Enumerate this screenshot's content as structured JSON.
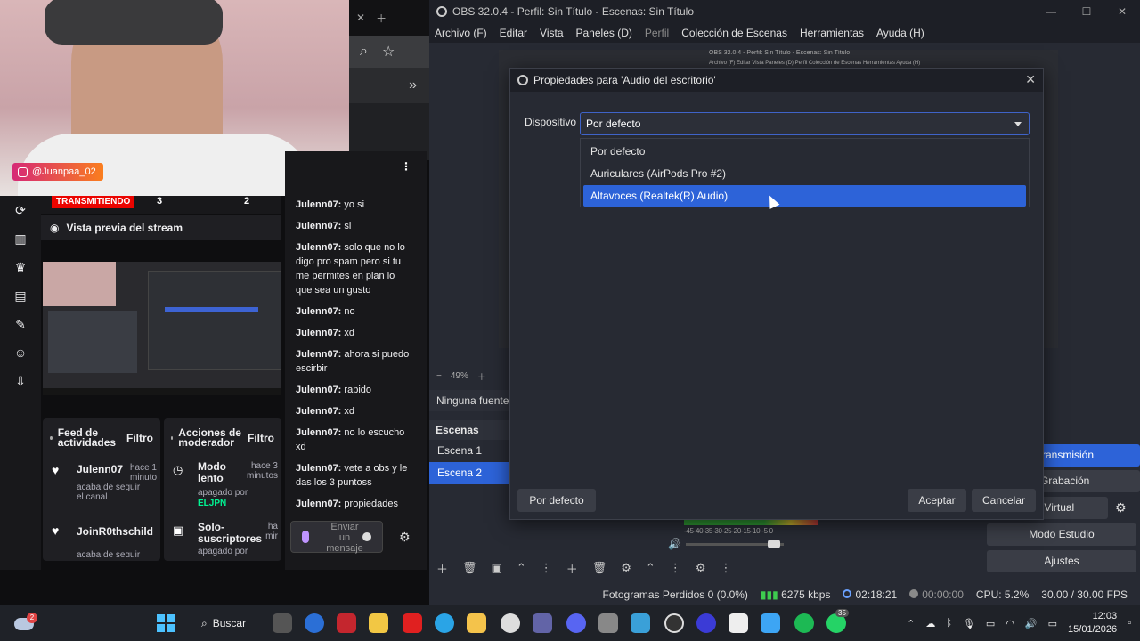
{
  "webcam": {
    "instagram_handle": "@Juanpaa_02"
  },
  "twitch": {
    "live_badge": "TRANSMITIENDO",
    "stats": [
      "3",
      "2"
    ],
    "preview_title": "Vista previa del stream",
    "feed": {
      "title": "Feed de actividades",
      "filter": "Filtro",
      "entries": [
        {
          "user": "Julenn07",
          "time": "hace 1 minuto",
          "desc": "acaba de seguir el canal"
        },
        {
          "user": "JoinR0thschild",
          "time": "",
          "desc": "acaba de seguir"
        }
      ]
    },
    "mod": {
      "title": "Acciones de moderador",
      "filter": "Filtro",
      "entries": [
        {
          "action": "Modo lento",
          "time": "hace 3 minutos",
          "desc": "apagado por",
          "by": "ELJPN"
        },
        {
          "action": "Solo-suscriptores",
          "time": "ha mir",
          "desc": "apagado por",
          "by": ""
        }
      ]
    },
    "chat": {
      "messages": [
        {
          "user": "Julenn07:",
          "text": "yo si"
        },
        {
          "user": "Julenn07:",
          "text": "si"
        },
        {
          "user": "Julenn07:",
          "text": "solo que no lo digo pro spam pero si tu me permites en plan lo que sea un gusto"
        },
        {
          "user": "Julenn07:",
          "text": "no"
        },
        {
          "user": "Julenn07:",
          "text": "xd"
        },
        {
          "user": "Julenn07:",
          "text": "ahora si puedo escirbir"
        },
        {
          "user": "Julenn07:",
          "text": "rapido"
        },
        {
          "user": "Julenn07:",
          "text": "xd"
        },
        {
          "user": "Julenn07:",
          "text": "no lo escucho xd"
        },
        {
          "user": "Julenn07:",
          "text": "vete a obs y le das los 3 puntoss"
        },
        {
          "user": "Julenn07:",
          "text": "propiedades"
        }
      ],
      "input_placeholder": "Enviar un mensaje"
    }
  },
  "obs": {
    "title": "OBS 32.0.4 - Perfil: Sin Título - Escenas: Sin Título",
    "menu": [
      "Archivo (F)",
      "Editar",
      "Vista",
      "Paneles (D)",
      "Perfil",
      "Colección de Escenas",
      "Herramientas",
      "Ayuda (H)"
    ],
    "mini_title": "OBS 32.0.4 - Perfil: Sin Título - Escenas: Sin Título",
    "mini_menu": "Archivo (F)   Editar   Vista   Paneles (D)   Perfil   Colección de Escenas   Herramientas   Ayuda (H)",
    "zoom": "49%",
    "no_source": "Ninguna fuente",
    "scenes_header": "Escenas",
    "scenes": [
      "Escena 1",
      "Escena 2"
    ],
    "selected_scene": "Escena 2",
    "controls": [
      "r Transmisión",
      "r Grabación",
      "mara Virtual",
      "Modo Estudio",
      "Ajustes"
    ],
    "mixer_scale": "-45-40-35-30-25-20-15-10 -5 0",
    "status": {
      "dropped": "Fotogramas Perdidos 0 (0.0%)",
      "bitrate": "6275 kbps",
      "live_time": "02:18:21",
      "rec_time": "00:00:00",
      "cpu": "CPU: 5.2%",
      "fps": "30.00 / 30.00 FPS"
    }
  },
  "dialog": {
    "title": "Propiedades para 'Audio del escritorio'",
    "device_label": "Dispositivo",
    "device_value": "Por defecto",
    "options": [
      "Por defecto",
      "Auriculares (AirPods Pro #2)",
      "Altavoces (Realtek(R) Audio)"
    ],
    "selected_option": "Altavoces (Realtek(R) Audio)",
    "defaults_button": "Por defecto",
    "accept_button": "Aceptar",
    "cancel_button": "Cancelar"
  },
  "taskbar": {
    "weather_badge": "2",
    "search": "Buscar",
    "chat_badge": "35",
    "time": "12:03",
    "date": "15/01/2026"
  }
}
